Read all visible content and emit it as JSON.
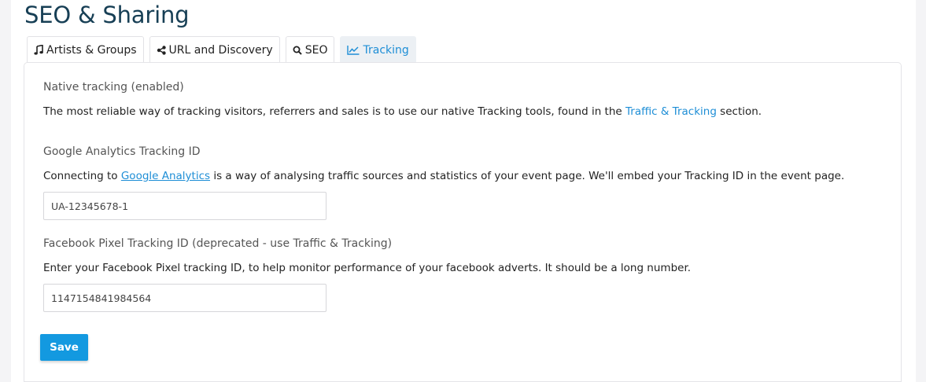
{
  "page": {
    "title": "SEO & Sharing"
  },
  "tabs": [
    {
      "label": "Artists & Groups",
      "icon": "music-note-icon",
      "active": false
    },
    {
      "label": "URL and Discovery",
      "icon": "share-icon",
      "active": false
    },
    {
      "label": "SEO",
      "icon": "search-icon",
      "active": false
    },
    {
      "label": "Tracking",
      "icon": "line-chart-icon",
      "active": true
    }
  ],
  "native": {
    "title": "Native tracking (enabled)",
    "text_before": "The most reliable way of tracking visitors, referrers and sales is to use our native Tracking tools, found in the ",
    "link": "Traffic & Tracking",
    "text_after": " section."
  },
  "google": {
    "title": "Google Analytics Tracking ID",
    "text_before": "Connecting to ",
    "link": "Google Analytics",
    "text_after": " is a way of analysing traffic sources and statistics of your event page. We'll embed your Tracking ID in the event page.",
    "value": "UA-12345678-1"
  },
  "facebook": {
    "title": "Facebook Pixel Tracking ID (deprecated - use Traffic & Tracking)",
    "text": "Enter your Facebook Pixel tracking ID, to help monitor performance of your facebook adverts. It should be a long number.",
    "value": "1147154841984564"
  },
  "actions": {
    "save_label": "Save"
  },
  "colors": {
    "accent": "#1e8ed6",
    "button": "#1399e0",
    "title": "#173f55"
  }
}
